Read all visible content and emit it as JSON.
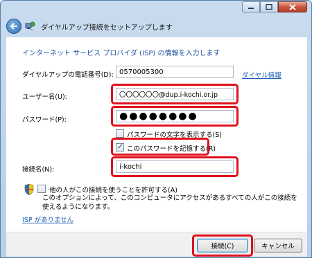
{
  "window": {
    "controls": [
      "minimize-icon",
      "maximize-icon",
      "close-icon"
    ]
  },
  "nav": {
    "title": "ダイヤルアップ接続をセットアップします"
  },
  "content": {
    "heading": "インターネット サービス プロバイダ (ISP) の情報を入力します",
    "phone": {
      "label": "ダイヤルアップの電話番号(D):",
      "value": "0570005300",
      "link": "ダイヤル情報"
    },
    "username": {
      "label": "ユーザー名(U):",
      "value": "〇〇〇〇〇〇@dup.i-kochi.or.jp"
    },
    "password": {
      "label": "パスワード(P):",
      "value": "●●●●●●●●"
    },
    "show_password": {
      "label": "パスワードの文字を表示する(S)",
      "checked": false
    },
    "remember_password": {
      "label": "このパスワードを記憶する(R)",
      "checked": true
    },
    "connection_name": {
      "label": "接続名(N):",
      "value": "i-kochi"
    },
    "allow_others": {
      "label": "他の人がこの接続を使うことを許可する(A)",
      "checked": false
    },
    "allow_desc": "このオプションによって、このコンピュータにアクセスがあるすべての人がこの接続を使えるようになります。",
    "no_isp_link": "ISP がありません"
  },
  "footer": {
    "connect_label": "接続(C)",
    "cancel_label": "キャンセル"
  },
  "colors": {
    "highlight": "#e0101c",
    "heading": "#1e4fa1",
    "link": "#1f5fb5"
  }
}
